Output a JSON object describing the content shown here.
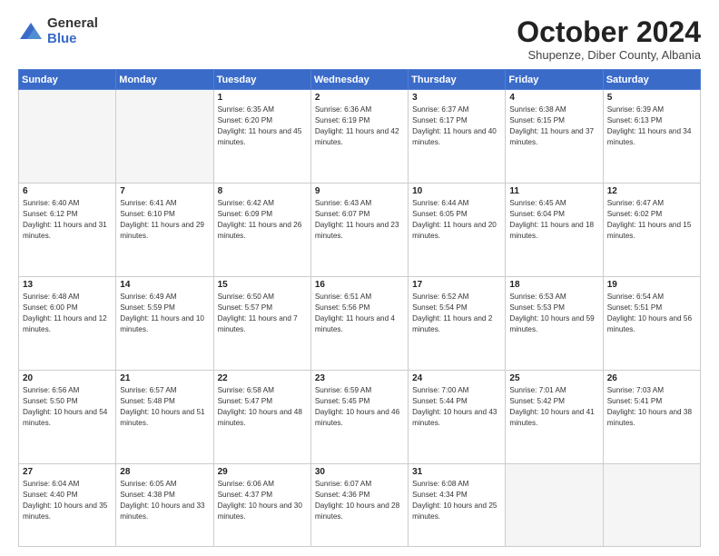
{
  "logo": {
    "general": "General",
    "blue": "Blue"
  },
  "header": {
    "month": "October 2024",
    "location": "Shupenze, Diber County, Albania"
  },
  "weekdays": [
    "Sunday",
    "Monday",
    "Tuesday",
    "Wednesday",
    "Thursday",
    "Friday",
    "Saturday"
  ],
  "weeks": [
    [
      {
        "day": "",
        "empty": true
      },
      {
        "day": "",
        "empty": true
      },
      {
        "day": "1",
        "sunrise": "6:35 AM",
        "sunset": "6:20 PM",
        "daylight": "11 hours and 45 minutes."
      },
      {
        "day": "2",
        "sunrise": "6:36 AM",
        "sunset": "6:19 PM",
        "daylight": "11 hours and 42 minutes."
      },
      {
        "day": "3",
        "sunrise": "6:37 AM",
        "sunset": "6:17 PM",
        "daylight": "11 hours and 40 minutes."
      },
      {
        "day": "4",
        "sunrise": "6:38 AM",
        "sunset": "6:15 PM",
        "daylight": "11 hours and 37 minutes."
      },
      {
        "day": "5",
        "sunrise": "6:39 AM",
        "sunset": "6:13 PM",
        "daylight": "11 hours and 34 minutes."
      }
    ],
    [
      {
        "day": "6",
        "sunrise": "6:40 AM",
        "sunset": "6:12 PM",
        "daylight": "11 hours and 31 minutes."
      },
      {
        "day": "7",
        "sunrise": "6:41 AM",
        "sunset": "6:10 PM",
        "daylight": "11 hours and 29 minutes."
      },
      {
        "day": "8",
        "sunrise": "6:42 AM",
        "sunset": "6:09 PM",
        "daylight": "11 hours and 26 minutes."
      },
      {
        "day": "9",
        "sunrise": "6:43 AM",
        "sunset": "6:07 PM",
        "daylight": "11 hours and 23 minutes."
      },
      {
        "day": "10",
        "sunrise": "6:44 AM",
        "sunset": "6:05 PM",
        "daylight": "11 hours and 20 minutes."
      },
      {
        "day": "11",
        "sunrise": "6:45 AM",
        "sunset": "6:04 PM",
        "daylight": "11 hours and 18 minutes."
      },
      {
        "day": "12",
        "sunrise": "6:47 AM",
        "sunset": "6:02 PM",
        "daylight": "11 hours and 15 minutes."
      }
    ],
    [
      {
        "day": "13",
        "sunrise": "6:48 AM",
        "sunset": "6:00 PM",
        "daylight": "11 hours and 12 minutes."
      },
      {
        "day": "14",
        "sunrise": "6:49 AM",
        "sunset": "5:59 PM",
        "daylight": "11 hours and 10 minutes."
      },
      {
        "day": "15",
        "sunrise": "6:50 AM",
        "sunset": "5:57 PM",
        "daylight": "11 hours and 7 minutes."
      },
      {
        "day": "16",
        "sunrise": "6:51 AM",
        "sunset": "5:56 PM",
        "daylight": "11 hours and 4 minutes."
      },
      {
        "day": "17",
        "sunrise": "6:52 AM",
        "sunset": "5:54 PM",
        "daylight": "11 hours and 2 minutes."
      },
      {
        "day": "18",
        "sunrise": "6:53 AM",
        "sunset": "5:53 PM",
        "daylight": "10 hours and 59 minutes."
      },
      {
        "day": "19",
        "sunrise": "6:54 AM",
        "sunset": "5:51 PM",
        "daylight": "10 hours and 56 minutes."
      }
    ],
    [
      {
        "day": "20",
        "sunrise": "6:56 AM",
        "sunset": "5:50 PM",
        "daylight": "10 hours and 54 minutes."
      },
      {
        "day": "21",
        "sunrise": "6:57 AM",
        "sunset": "5:48 PM",
        "daylight": "10 hours and 51 minutes."
      },
      {
        "day": "22",
        "sunrise": "6:58 AM",
        "sunset": "5:47 PM",
        "daylight": "10 hours and 48 minutes."
      },
      {
        "day": "23",
        "sunrise": "6:59 AM",
        "sunset": "5:45 PM",
        "daylight": "10 hours and 46 minutes."
      },
      {
        "day": "24",
        "sunrise": "7:00 AM",
        "sunset": "5:44 PM",
        "daylight": "10 hours and 43 minutes."
      },
      {
        "day": "25",
        "sunrise": "7:01 AM",
        "sunset": "5:42 PM",
        "daylight": "10 hours and 41 minutes."
      },
      {
        "day": "26",
        "sunrise": "7:03 AM",
        "sunset": "5:41 PM",
        "daylight": "10 hours and 38 minutes."
      }
    ],
    [
      {
        "day": "27",
        "sunrise": "6:04 AM",
        "sunset": "4:40 PM",
        "daylight": "10 hours and 35 minutes."
      },
      {
        "day": "28",
        "sunrise": "6:05 AM",
        "sunset": "4:38 PM",
        "daylight": "10 hours and 33 minutes."
      },
      {
        "day": "29",
        "sunrise": "6:06 AM",
        "sunset": "4:37 PM",
        "daylight": "10 hours and 30 minutes."
      },
      {
        "day": "30",
        "sunrise": "6:07 AM",
        "sunset": "4:36 PM",
        "daylight": "10 hours and 28 minutes."
      },
      {
        "day": "31",
        "sunrise": "6:08 AM",
        "sunset": "4:34 PM",
        "daylight": "10 hours and 25 minutes."
      },
      {
        "day": "",
        "empty": true
      },
      {
        "day": "",
        "empty": true
      }
    ]
  ]
}
